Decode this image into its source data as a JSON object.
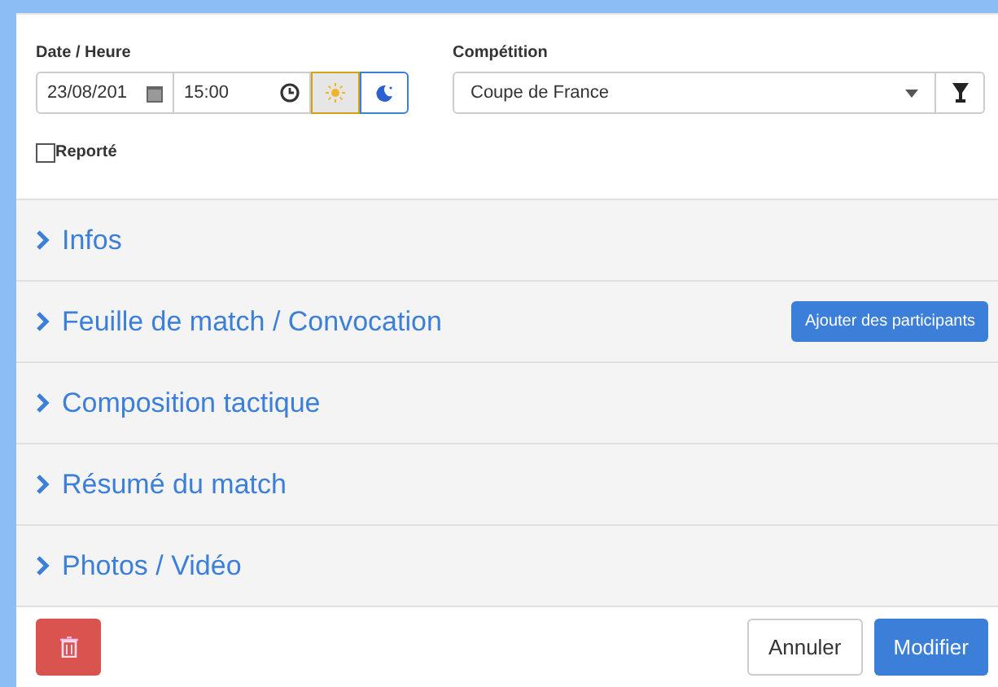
{
  "datetime": {
    "label": "Date / Heure",
    "date": "23/08/201",
    "time": "15:00"
  },
  "period_toggle": [
    {
      "kind": "sun",
      "selected": true
    },
    {
      "kind": "moon",
      "selected": false
    }
  ],
  "competition": {
    "label": "Compétition",
    "value": "Coupe de France"
  },
  "postponed": {
    "label": "Reporté",
    "checked": false
  },
  "sections": [
    {
      "title": "Infos",
      "expanded": false
    },
    {
      "title": "Feuille de match / Convocation",
      "expanded": false,
      "action": "Ajouter des participants"
    },
    {
      "title": "Composition tactique",
      "expanded": false
    },
    {
      "title": "Résumé du match",
      "expanded": false
    },
    {
      "title": "Photos / Vidéo",
      "expanded": false
    }
  ],
  "footer": {
    "cancel": "Annuler",
    "submit": "Modifier"
  }
}
